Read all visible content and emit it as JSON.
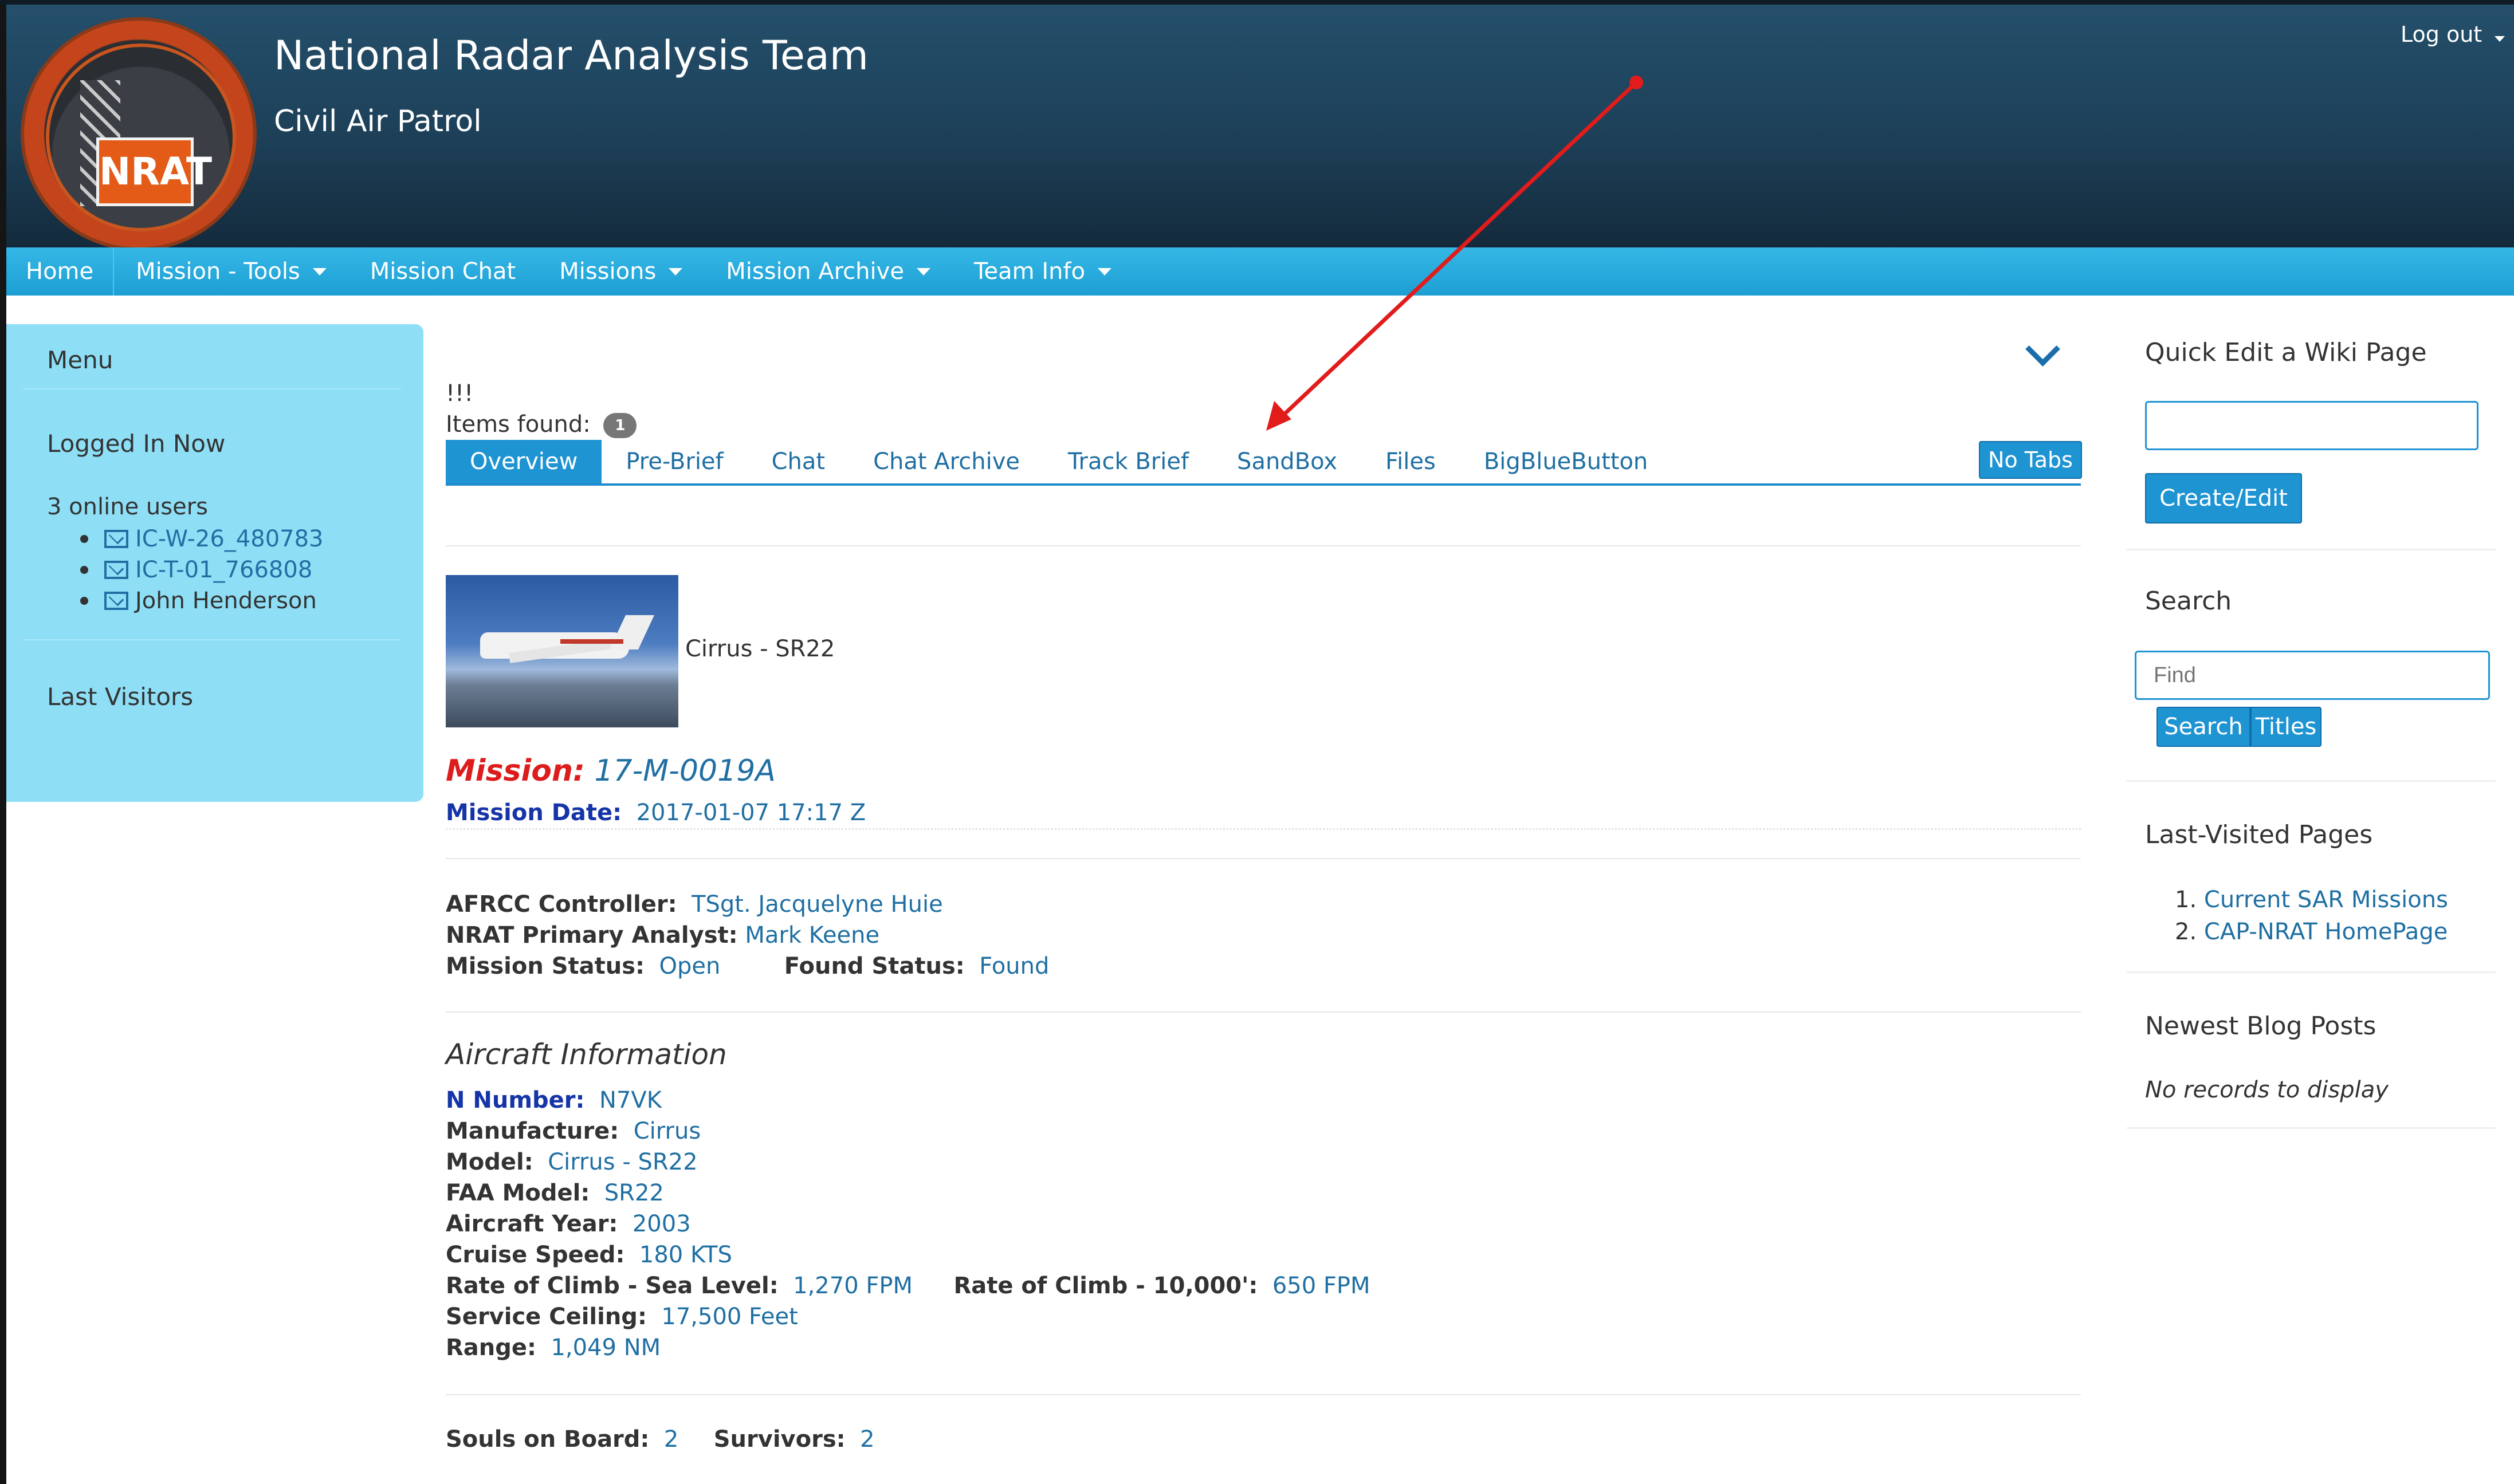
{
  "header": {
    "title": "National Radar Analysis Team",
    "subtitle": "Civil Air Patrol",
    "logo_text": "NRAT",
    "logout_label": "Log out"
  },
  "nav": {
    "items": [
      {
        "label": "Home",
        "dropdown": false
      },
      {
        "label": "Mission - Tools",
        "dropdown": true
      },
      {
        "label": "Mission Chat",
        "dropdown": false
      },
      {
        "label": "Missions",
        "dropdown": true
      },
      {
        "label": "Mission Archive",
        "dropdown": true
      },
      {
        "label": "Team Info",
        "dropdown": true
      }
    ]
  },
  "sidebar": {
    "menu_title": "Menu",
    "logged_in_title": "Logged In Now",
    "online_count": "3 online users",
    "users": [
      "IC-W-26_480783",
      "IC-T-01_766808",
      "John Henderson"
    ],
    "last_visitors_title": "Last Visitors"
  },
  "main": {
    "exclaim": "!!!",
    "items_found_label": "Items found:",
    "items_found_count": "1",
    "tabs": [
      "Overview",
      "Pre-Brief",
      "Chat",
      "Chat Archive",
      "Track Brief",
      "SandBox",
      "Files",
      "BigBlueButton"
    ],
    "active_tab": "Overview",
    "no_tabs_label": "No Tabs",
    "aircraft_caption": "Cirrus - SR22",
    "mission_label": "Mission:",
    "mission_value": "17-M-0019A",
    "mission_date_label": "Mission Date:",
    "mission_date_value": "2017-01-07 17:17 Z",
    "controller_label": "AFRCC Controller:",
    "controller_value": "TSgt. Jacquelyne Huie",
    "analyst_label": "NRAT Primary Analyst:",
    "analyst_value": "Mark Keene",
    "status_label": "Mission Status:",
    "status_value": "Open",
    "found_label": "Found Status:",
    "found_value": "Found",
    "aircraft_heading": "Aircraft Information",
    "n_number_label": "N Number:",
    "n_number_value": "N7VK",
    "manufacture_label": "Manufacture:",
    "manufacture_value": "Cirrus",
    "model_label": "Model:",
    "model_value": "Cirrus - SR22",
    "faa_label": "FAA Model:",
    "faa_value": "SR22",
    "year_label": "Aircraft Year:",
    "year_value": "2003",
    "cruise_label": "Cruise Speed:",
    "cruise_value": "180 KTS",
    "roc_sea_label": "Rate of Climb - Sea Level:",
    "roc_sea_value": "1,270 FPM",
    "roc_10k_label": "Rate of Climb - 10,000':",
    "roc_10k_value": "650 FPM",
    "ceiling_label": "Service Ceiling:",
    "ceiling_value": "17,500 Feet",
    "range_label": "Range:",
    "range_value": "1,049 NM",
    "souls_label": "Souls on Board:",
    "souls_value": "2",
    "survivors_label": "Survivors:",
    "survivors_value": "2"
  },
  "right": {
    "quick_edit_title": "Quick Edit a Wiki Page",
    "quick_edit_value": "",
    "create_edit_label": "Create/Edit",
    "search_title": "Search",
    "search_placeholder": "Find",
    "search_button": "Search",
    "titles_button": "Titles",
    "last_visited_title": "Last-Visited Pages",
    "last_visited": [
      "Current SAR Missions",
      "CAP-NRAT HomePage"
    ],
    "blog_title": "Newest Blog Posts",
    "blog_empty": "No records to display"
  },
  "colors": {
    "header_bg": "#1d4058",
    "nav_bg": "#2aaee2",
    "sidebar_bg": "#8edff6",
    "link": "#1f6fa3",
    "mission_red": "#dd1c1c",
    "annotation_arrow": "#e21b1b"
  },
  "icons": {
    "user_mail": "envelope-icon",
    "collapse": "chevron-down-icon",
    "nav_dropdown": "caret-down-icon"
  }
}
